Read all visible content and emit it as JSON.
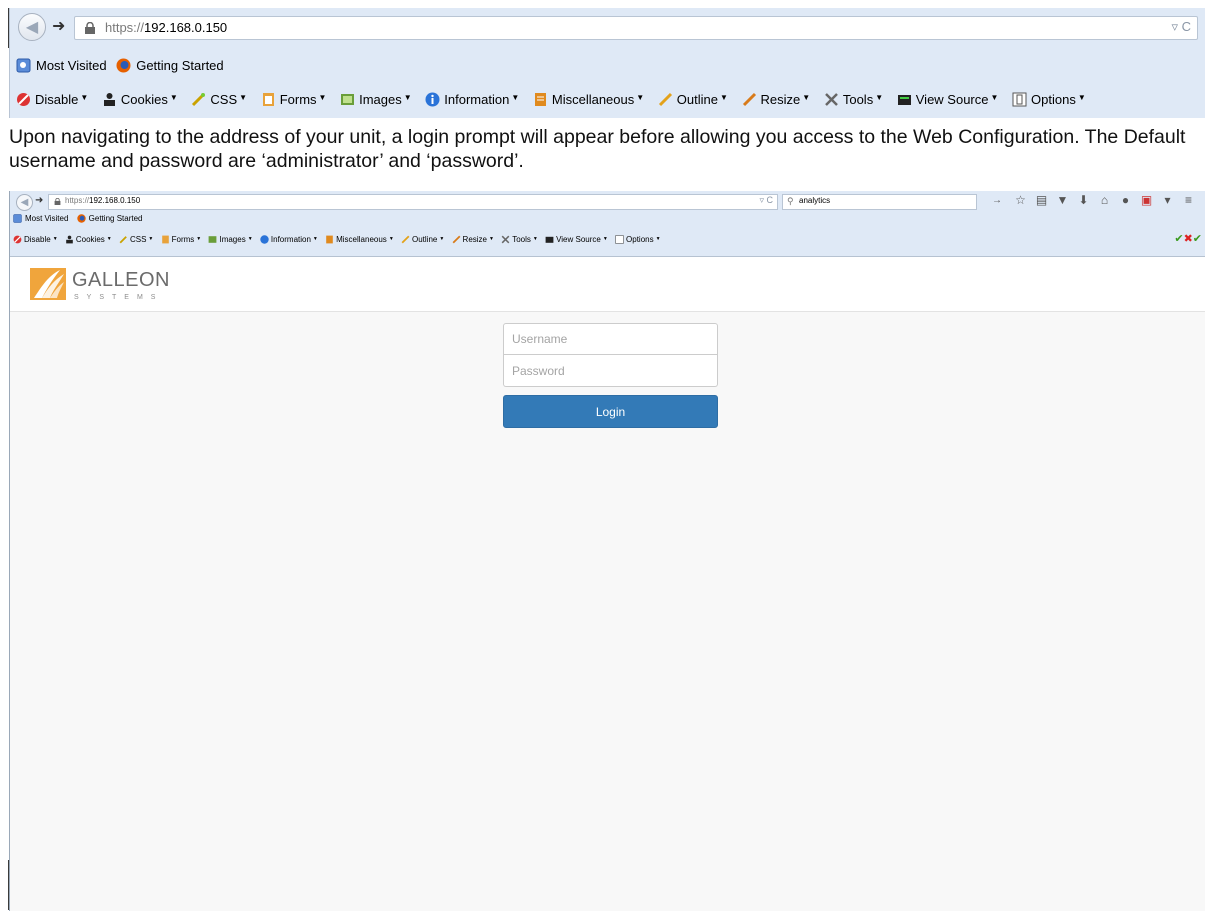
{
  "outer_browser": {
    "url_scheme": "https://",
    "url_host": "192.168.0.150",
    "url_right": "▿ C",
    "bookmarks": [
      {
        "label": "Most Visited",
        "icon": "bookmark-folder-icon"
      },
      {
        "label": "Getting Started",
        "icon": "firefox-icon"
      }
    ],
    "devtools": [
      "Disable",
      "Cookies",
      "CSS",
      "Forms",
      "Images",
      "Information",
      "Miscellaneous",
      "Outline",
      "Resize",
      "Tools",
      "View Source",
      "Options"
    ]
  },
  "paragraph": "Upon navigating to the address of your unit, a login prompt will appear before allowing you access to the Web Configuration. The Default username and password are ‘administrator’ and ‘password’.",
  "inner_browser": {
    "url_scheme": "https://",
    "url_host": "192.168.0.150",
    "url_right": "▿ C",
    "search_value": "analytics",
    "bookmarks": [
      "Most Visited",
      "Getting Started"
    ],
    "devtools": [
      "Disable",
      "Cookies",
      "CSS",
      "Forms",
      "Images",
      "Information",
      "Miscellaneous",
      "Outline",
      "Resize",
      "Tools",
      "View Source",
      "Options"
    ]
  },
  "page": {
    "logo_name": "GALLEON",
    "logo_sub": "SYSTEMS",
    "username_placeholder": "Username",
    "password_placeholder": "Password",
    "login_label": "Login",
    "accent_color": "#337ab7",
    "logo_color": "#f0a53c"
  }
}
